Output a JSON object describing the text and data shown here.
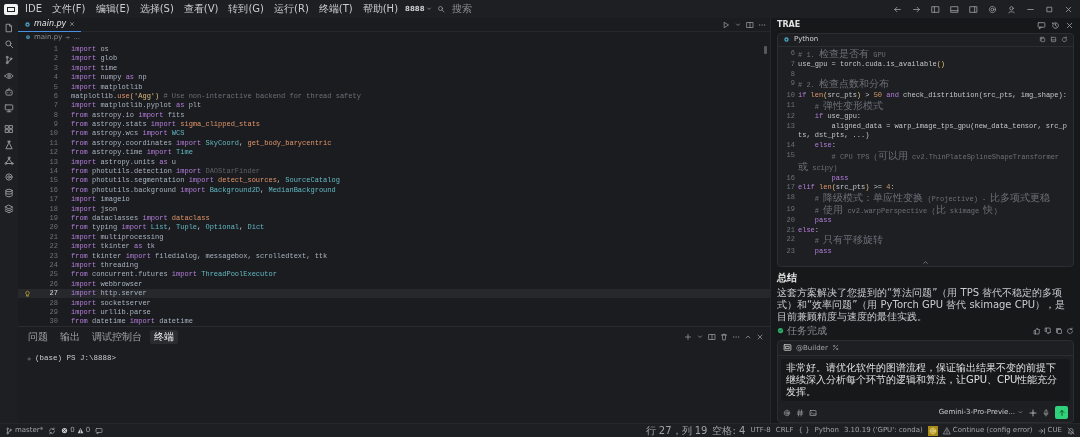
{
  "window": {
    "logo_label": "IDE",
    "menus": [
      "文件(F)",
      "编辑(E)",
      "选择(S)",
      "查看(V)",
      "转到(G)",
      "运行(R)",
      "终端(T)",
      "帮助(H)"
    ],
    "project": "8888",
    "search_placeholder": "搜索"
  },
  "editor": {
    "tabs": [
      {
        "label": "main.py",
        "selected": true
      }
    ],
    "breadcrumb": [
      "main.py",
      "..."
    ],
    "lines": [
      {
        "number": "1",
        "current": false,
        "tokens": [
          {
            "kind": "keyword",
            "text": "import "
          },
          {
            "kind": "module",
            "text": "os"
          }
        ]
      },
      {
        "number": "2",
        "current": false,
        "tokens": [
          {
            "kind": "keyword",
            "text": "import "
          },
          {
            "kind": "module",
            "text": "glob"
          }
        ]
      },
      {
        "number": "3",
        "current": false,
        "tokens": [
          {
            "kind": "keyword",
            "text": "import "
          },
          {
            "kind": "module",
            "text": "time"
          }
        ]
      },
      {
        "number": "4",
        "current": false,
        "tokens": [
          {
            "kind": "keyword",
            "text": "import "
          },
          {
            "kind": "module",
            "text": "numpy "
          },
          {
            "kind": "keyword",
            "text": "as "
          },
          {
            "kind": "module",
            "text": "np"
          }
        ]
      },
      {
        "number": "5",
        "current": false,
        "tokens": [
          {
            "kind": "keyword",
            "text": "import "
          },
          {
            "kind": "module",
            "text": "matplotlib"
          }
        ]
      },
      {
        "number": "6",
        "current": false,
        "tokens": [
          {
            "kind": "module",
            "text": "matplotlib."
          },
          {
            "kind": "function",
            "text": "use"
          },
          {
            "kind": "bracket",
            "text": "("
          },
          {
            "kind": "string",
            "text": "'Agg'"
          },
          {
            "kind": "bracket",
            "text": ")"
          },
          {
            "kind": "comment",
            "text": " # Use non-interactive backend for thread safety"
          }
        ]
      },
      {
        "number": "7",
        "current": false,
        "tokens": [
          {
            "kind": "keyword",
            "text": "import "
          },
          {
            "kind": "module",
            "text": "matplotlib.pyplot "
          },
          {
            "kind": "keyword",
            "text": "as "
          },
          {
            "kind": "module",
            "text": "plt"
          }
        ]
      },
      {
        "number": "8",
        "current": false,
        "tokens": [
          {
            "kind": "keyword",
            "text": "from "
          },
          {
            "kind": "module",
            "text": "astropy.io "
          },
          {
            "kind": "keyword",
            "text": "import "
          },
          {
            "kind": "module",
            "text": "fits"
          }
        ]
      },
      {
        "number": "9",
        "current": false,
        "tokens": [
          {
            "kind": "keyword",
            "text": "from "
          },
          {
            "kind": "module",
            "text": "astropy.stats "
          },
          {
            "kind": "keyword",
            "text": "import "
          },
          {
            "kind": "function",
            "text": "sigma_clipped_stats"
          }
        ]
      },
      {
        "number": "10",
        "current": false,
        "tokens": [
          {
            "kind": "keyword",
            "text": "from "
          },
          {
            "kind": "module",
            "text": "astropy.wcs "
          },
          {
            "kind": "keyword",
            "text": "import "
          },
          {
            "kind": "class",
            "text": "WCS"
          }
        ]
      },
      {
        "number": "11",
        "current": false,
        "tokens": [
          {
            "kind": "keyword",
            "text": "from "
          },
          {
            "kind": "module",
            "text": "astropy.coordinates "
          },
          {
            "kind": "keyword",
            "text": "import "
          },
          {
            "kind": "class",
            "text": "SkyCoord"
          },
          {
            "kind": "plain",
            "text": ", "
          },
          {
            "kind": "function",
            "text": "get_body_barycentric"
          }
        ]
      },
      {
        "number": "12",
        "current": false,
        "tokens": [
          {
            "kind": "keyword",
            "text": "from "
          },
          {
            "kind": "module",
            "text": "astropy.time "
          },
          {
            "kind": "keyword",
            "text": "import "
          },
          {
            "kind": "class",
            "text": "Time"
          }
        ]
      },
      {
        "number": "13",
        "current": false,
        "tokens": [
          {
            "kind": "keyword",
            "text": "import "
          },
          {
            "kind": "module",
            "text": "astropy.units "
          },
          {
            "kind": "keyword",
            "text": "as "
          },
          {
            "kind": "module",
            "text": "u"
          }
        ]
      },
      {
        "number": "14",
        "current": false,
        "tokens": [
          {
            "kind": "keyword",
            "text": "from "
          },
          {
            "kind": "module",
            "text": "photutils.detection "
          },
          {
            "kind": "keyword",
            "text": "import "
          },
          {
            "kind": "unused",
            "text": "DAOStarFinder"
          }
        ]
      },
      {
        "number": "15",
        "current": false,
        "tokens": [
          {
            "kind": "keyword",
            "text": "from "
          },
          {
            "kind": "module",
            "text": "photutils.segmentation "
          },
          {
            "kind": "keyword",
            "text": "import "
          },
          {
            "kind": "function",
            "text": "detect_sources"
          },
          {
            "kind": "plain",
            "text": ", "
          },
          {
            "kind": "class",
            "text": "SourceCatalog"
          }
        ]
      },
      {
        "number": "16",
        "current": false,
        "tokens": [
          {
            "kind": "keyword",
            "text": "from "
          },
          {
            "kind": "module",
            "text": "photutils.background "
          },
          {
            "kind": "keyword",
            "text": "import "
          },
          {
            "kind": "class",
            "text": "Background2D"
          },
          {
            "kind": "plain",
            "text": ", "
          },
          {
            "kind": "class",
            "text": "MedianBackground"
          }
        ]
      },
      {
        "number": "17",
        "current": false,
        "tokens": [
          {
            "kind": "keyword",
            "text": "import "
          },
          {
            "kind": "module",
            "text": "imageio"
          }
        ]
      },
      {
        "number": "18",
        "current": false,
        "tokens": [
          {
            "kind": "keyword",
            "text": "import "
          },
          {
            "kind": "module",
            "text": "json"
          }
        ]
      },
      {
        "number": "19",
        "current": false,
        "tokens": [
          {
            "kind": "keyword",
            "text": "from "
          },
          {
            "kind": "module",
            "text": "dataclasses "
          },
          {
            "kind": "keyword",
            "text": "import "
          },
          {
            "kind": "function",
            "text": "dataclass"
          }
        ]
      },
      {
        "number": "20",
        "current": false,
        "tokens": [
          {
            "kind": "keyword",
            "text": "from "
          },
          {
            "kind": "module",
            "text": "typing "
          },
          {
            "kind": "keyword",
            "text": "import "
          },
          {
            "kind": "class",
            "text": "List"
          },
          {
            "kind": "plain",
            "text": ", "
          },
          {
            "kind": "class",
            "text": "Tuple"
          },
          {
            "kind": "plain",
            "text": ", "
          },
          {
            "kind": "class",
            "text": "Optional"
          },
          {
            "kind": "plain",
            "text": ", "
          },
          {
            "kind": "class",
            "text": "Dict"
          }
        ]
      },
      {
        "number": "21",
        "current": false,
        "tokens": [
          {
            "kind": "keyword",
            "text": "import "
          },
          {
            "kind": "module",
            "text": "multiprocessing"
          }
        ]
      },
      {
        "number": "22",
        "current": false,
        "tokens": [
          {
            "kind": "keyword",
            "text": "import "
          },
          {
            "kind": "module",
            "text": "tkinter "
          },
          {
            "kind": "keyword",
            "text": "as "
          },
          {
            "kind": "module",
            "text": "tk"
          }
        ]
      },
      {
        "number": "23",
        "current": false,
        "tokens": [
          {
            "kind": "keyword",
            "text": "from "
          },
          {
            "kind": "module",
            "text": "tkinter "
          },
          {
            "kind": "keyword",
            "text": "import "
          },
          {
            "kind": "module",
            "text": "filedialog, messagebox, scrolledtext, ttk"
          }
        ]
      },
      {
        "number": "24",
        "current": false,
        "tokens": [
          {
            "kind": "keyword",
            "text": "import "
          },
          {
            "kind": "module",
            "text": "threading"
          }
        ]
      },
      {
        "number": "25",
        "current": false,
        "tokens": [
          {
            "kind": "keyword",
            "text": "from "
          },
          {
            "kind": "module",
            "text": "concurrent.futures "
          },
          {
            "kind": "keyword",
            "text": "import "
          },
          {
            "kind": "class",
            "text": "ThreadPoolExecutor"
          }
        ]
      },
      {
        "number": "26",
        "current": false,
        "tokens": [
          {
            "kind": "keyword",
            "text": "import "
          },
          {
            "kind": "module",
            "text": "webbrowser"
          }
        ]
      },
      {
        "number": "27",
        "current": true,
        "tokens": [
          {
            "kind": "keyword",
            "text": "import "
          },
          {
            "kind": "module",
            "text": "http.server"
          }
        ]
      },
      {
        "number": "28",
        "current": false,
        "tokens": [
          {
            "kind": "keyword",
            "text": "import "
          },
          {
            "kind": "module",
            "text": "socketserver"
          }
        ]
      },
      {
        "number": "29",
        "current": false,
        "tokens": [
          {
            "kind": "keyword",
            "text": "import "
          },
          {
            "kind": "module",
            "text": "urllib.parse"
          }
        ]
      },
      {
        "number": "30",
        "current": false,
        "tokens": [
          {
            "kind": "keyword",
            "text": "from "
          },
          {
            "kind": "module",
            "text": "datetime "
          },
          {
            "kind": "keyword",
            "text": "import "
          },
          {
            "kind": "module",
            "text": "datetime"
          }
        ]
      }
    ]
  },
  "terminal": {
    "tabs": [
      {
        "label": "问题",
        "selected": false
      },
      {
        "label": "输出",
        "selected": false
      },
      {
        "label": "调试控制台",
        "selected": false
      },
      {
        "label": "终端",
        "selected": true
      }
    ],
    "lines": [
      "(base) PS J:\\8888>"
    ]
  },
  "assistant": {
    "title": "TRAE",
    "code_block": {
      "language": "Python",
      "lines": [
        {
          "number": "6",
          "tokens": [
            {
              "kind": "comment",
              "text": "# 1. 检查是否有 GPU"
            }
          ]
        },
        {
          "number": "7",
          "tokens": [
            {
              "kind": "plain",
              "text": "use_gpu = torch.cuda.is_available"
            },
            {
              "kind": "bracket",
              "text": "()"
            }
          ]
        },
        {
          "number": "8"
        },
        {
          "number": "9",
          "tokens": [
            {
              "kind": "comment",
              "text": "# 2. 检查点数和分布"
            }
          ]
        },
        {
          "number": "10",
          "tokens": [
            {
              "kind": "keyword",
              "text": "if "
            },
            {
              "kind": "function",
              "text": "len"
            },
            {
              "kind": "bracket",
              "text": "("
            },
            {
              "kind": "plain",
              "text": "src_pts"
            },
            {
              "kind": "bracket",
              "text": ")"
            },
            {
              "kind": "plain",
              "text": " > "
            },
            {
              "kind": "number",
              "text": "50"
            },
            {
              "kind": "keyword",
              "text": " and "
            },
            {
              "kind": "plain",
              "text": "check_distribution(src_pts, img_shape):"
            }
          ]
        },
        {
          "number": "11",
          "tokens": [
            {
              "kind": "comment",
              "text": "    # 弹性变形模式"
            }
          ]
        },
        {
          "number": "12",
          "tokens": [
            {
              "kind": "keyword",
              "text": "    if "
            },
            {
              "kind": "plain",
              "text": "use_gpu:"
            }
          ]
        },
        {
          "number": "13",
          "tokens": [
            {
              "kind": "plain",
              "text": "        aligned_data = warp_image_tps_gpu(new_data_tensor, src_pts, dst_pts, ...)"
            }
          ]
        },
        {
          "number": "14",
          "tokens": [
            {
              "kind": "keyword",
              "text": "    else"
            },
            {
              "kind": "plain",
              "text": ":"
            }
          ]
        },
        {
          "number": "15",
          "tokens": [
            {
              "kind": "comment",
              "text": "        # CPU TPS (可以用 cv2.ThinPlateSplineShapeTransformer 或 scipy)"
            }
          ]
        },
        {
          "number": "16",
          "tokens": [
            {
              "kind": "keyword",
              "text": "        pass"
            }
          ]
        },
        {
          "number": "17",
          "tokens": [
            {
              "kind": "keyword",
              "text": "elif "
            },
            {
              "kind": "function",
              "text": "len"
            },
            {
              "kind": "bracket",
              "text": "("
            },
            {
              "kind": "plain",
              "text": "src_pts"
            },
            {
              "kind": "bracket",
              "text": ")"
            },
            {
              "kind": "plain",
              "text": " >= "
            },
            {
              "kind": "number",
              "text": "4"
            },
            {
              "kind": "plain",
              "text": ":"
            }
          ]
        },
        {
          "number": "18",
          "tokens": [
            {
              "kind": "comment",
              "text": "    # 降级模式：单应性变换 (Projective) - 比多项式更稳"
            }
          ]
        },
        {
          "number": "19",
          "tokens": [
            {
              "kind": "comment",
              "text": "    # 使用 cv2.warpPerspective (比 skimage 快)"
            }
          ]
        },
        {
          "number": "20",
          "tokens": [
            {
              "kind": "keyword",
              "text": "    pass"
            }
          ]
        },
        {
          "number": "21",
          "tokens": [
            {
              "kind": "keyword",
              "text": "else"
            },
            {
              "kind": "plain",
              "text": ":"
            }
          ]
        },
        {
          "number": "22",
          "tokens": [
            {
              "kind": "comment",
              "text": "    # 只有平移旋转"
            }
          ]
        },
        {
          "number": "23",
          "tokens": [
            {
              "kind": "keyword",
              "text": "    pass"
            }
          ]
        }
      ]
    },
    "summary": {
      "heading": "总结",
      "text": "这套方案解决了您提到的“算法问题”（用 TPS 替代不稳定的多项式）和“效率问题”（用 PyTorch GPU 替代 skimage CPU），是目前兼顾精度与速度的最佳实践。"
    },
    "status": "任务完成",
    "input": {
      "agent": "@Builder",
      "value": "非常好。请优化软件的图谱流程，保证输出结果不变的前提下继续深入分析每个环节的逻辑和算法，让GPU、CPU性能充分发挥。",
      "model": "Gemini-3-Pro-Previe..."
    }
  },
  "status_bar": {
    "branch": "master*",
    "errors": "0",
    "warnings": "0",
    "items": [
      {
        "kind": "text",
        "text": "行 27，列 19"
      },
      {
        "kind": "text",
        "text": "空格: 4"
      },
      {
        "kind": "text",
        "text": "UTF-8"
      },
      {
        "kind": "text",
        "text": "CRLF"
      },
      {
        "kind": "text",
        "text": "{ }"
      },
      {
        "kind": "text",
        "text": "Python"
      },
      {
        "kind": "text",
        "text": "3.10.19 ('GPU': conda)"
      },
      {
        "kind": "extension"
      },
      {
        "kind": "alert",
        "text": "Continue (config error)"
      },
      {
        "kind": "remote",
        "text": "CUE"
      }
    ]
  }
}
